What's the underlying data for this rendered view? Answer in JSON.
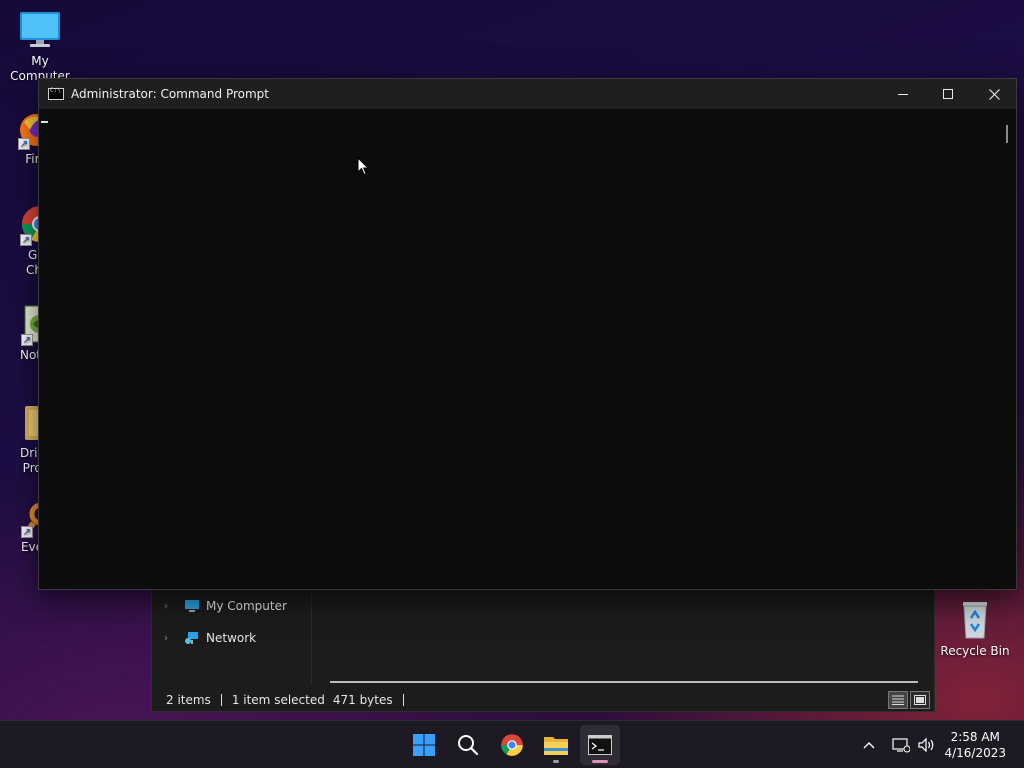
{
  "desktop": {
    "icons": [
      {
        "label": "My Computer",
        "icon": "monitor-icon"
      },
      {
        "label": "Fire",
        "icon": "firefox-icon"
      },
      {
        "label_line1": "Goo",
        "label_line2": "Chro",
        "icon": "chrome-icon"
      },
      {
        "label": "Notep",
        "icon": "notepad-icon"
      },
      {
        "label_line1": "Drive",
        "label_line2": "Prog",
        "icon": "folder-icon"
      },
      {
        "label": "Every",
        "icon": "everything-search-icon"
      },
      {
        "label": "Recycle Bin",
        "icon": "recycle-bin-icon"
      }
    ]
  },
  "cmd_window": {
    "title": "Administrator:  Command Prompt",
    "minimize_icon": "minimize-icon",
    "maximize_icon": "maximize-icon",
    "close_icon": "close-icon"
  },
  "explorer": {
    "nav_items": [
      {
        "label": "My Computer",
        "icon": "monitor-icon"
      },
      {
        "label": "Network",
        "icon": "network-icon"
      }
    ],
    "status": {
      "items": "2 items",
      "selected": "1 item selected",
      "size": "471 bytes"
    }
  },
  "taskbar": {
    "apps": [
      "start-icon",
      "search-icon",
      "chrome-icon",
      "file-explorer-icon",
      "terminal-icon"
    ],
    "tray": [
      "chevron-up-icon",
      "network-icon",
      "volume-icon"
    ],
    "time": "2:58 AM",
    "date": "4/16/2023"
  },
  "colors": {
    "accent_indicator": "#e58fb5",
    "terminal_bg": "#0c0c0c",
    "titlebar_bg": "#1f1f1f"
  }
}
